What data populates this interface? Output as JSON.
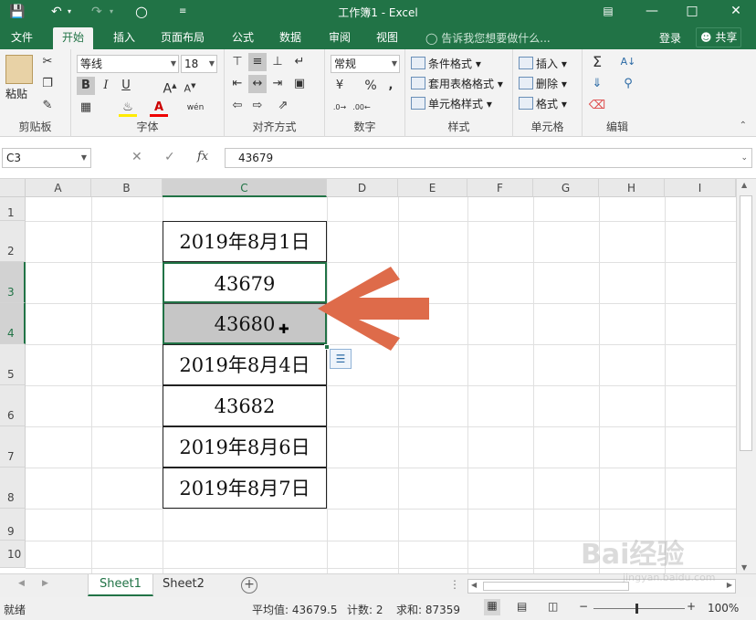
{
  "titlebar": {
    "title": "工作簿1 - Excel",
    "save_icon": "save-icon",
    "undo_icon": "undo-icon",
    "redo_icon": "redo-icon",
    "circle_icon": "touch-mode-icon",
    "customize_icon": "customize-qat-icon"
  },
  "tabs": [
    {
      "label": "文件",
      "active": false
    },
    {
      "label": "开始",
      "active": true
    },
    {
      "label": "插入",
      "active": false
    },
    {
      "label": "页面布局",
      "active": false
    },
    {
      "label": "公式",
      "active": false
    },
    {
      "label": "数据",
      "active": false
    },
    {
      "label": "审阅",
      "active": false
    },
    {
      "label": "视图",
      "active": false
    }
  ],
  "tellme": "告诉我您想要做什么...",
  "login": "登录",
  "share": "共享",
  "ribbon": {
    "clipboard": {
      "label": "剪贴板",
      "paste": "粘贴"
    },
    "font": {
      "label": "字体",
      "name": "等线",
      "size": "18",
      "bold": "B",
      "italic": "I",
      "underline": "U",
      "wen": "wén"
    },
    "alignment": {
      "label": "对齐方式"
    },
    "number": {
      "label": "数字",
      "format": "常规",
      "percent": "%"
    },
    "styles": {
      "label": "样式",
      "cond": "条件格式",
      "table": "套用表格格式",
      "cell": "单元格样式"
    },
    "cells": {
      "label": "单元格",
      "insert": "插入",
      "delete": "删除",
      "format": "格式"
    },
    "editing": {
      "label": "编辑"
    }
  },
  "formula_bar": {
    "namebox": "C3",
    "value": "43679"
  },
  "columns": [
    "A",
    "B",
    "C",
    "D",
    "E",
    "F",
    "G",
    "H",
    "I"
  ],
  "rows": [
    "1",
    "2",
    "3",
    "4",
    "5",
    "6",
    "7",
    "8",
    "9",
    "10"
  ],
  "cells": [
    {
      "ref": "C2",
      "text": "2019年8月1日"
    },
    {
      "ref": "C3",
      "text": "43679"
    },
    {
      "ref": "C4",
      "text": "43680"
    },
    {
      "ref": "C5",
      "text": "2019年8月4日"
    },
    {
      "ref": "C6",
      "text": "43682"
    },
    {
      "ref": "C7",
      "text": "2019年8月6日"
    },
    {
      "ref": "C8",
      "text": "2019年8月7日"
    }
  ],
  "sheets": [
    "Sheet1",
    "Sheet2"
  ],
  "status": {
    "ready": "就绪",
    "average": "平均值: 43679.5",
    "count": "计数: 2",
    "sum": "求和: 87359",
    "zoom": "100%"
  },
  "colors": {
    "excel_green": "#217346",
    "arrow": "#de6b4a"
  },
  "watermark": {
    "line1": "Bai经验",
    "line2": "jingyan.baidu.com"
  }
}
